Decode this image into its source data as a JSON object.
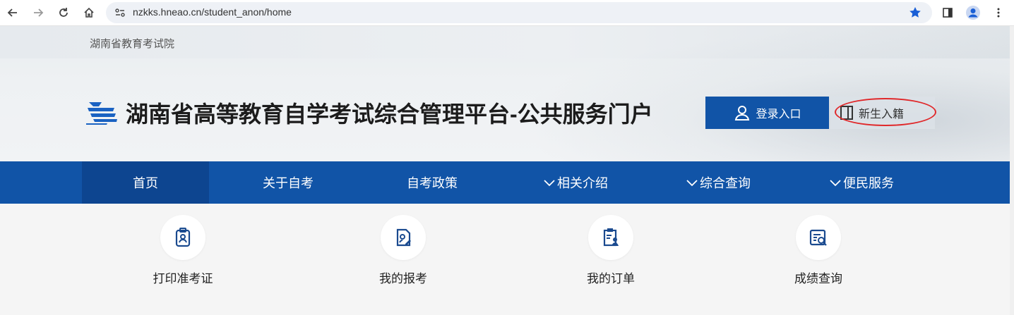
{
  "browser": {
    "url": "nzkks.hneao.cn/student_anon/home"
  },
  "header": {
    "org_name": "湖南省教育考试院",
    "title": "湖南省高等教育自学考试综合管理平台-公共服务门户",
    "login_label": "登录入口",
    "new_student_label": "新生入籍"
  },
  "nav": {
    "items": [
      {
        "label": "首页",
        "has_dropdown": false
      },
      {
        "label": "关于自考",
        "has_dropdown": false
      },
      {
        "label": "自考政策",
        "has_dropdown": false
      },
      {
        "label": "相关介绍",
        "has_dropdown": true
      },
      {
        "label": "综合查询",
        "has_dropdown": true
      },
      {
        "label": "便民服务",
        "has_dropdown": true
      }
    ]
  },
  "quick_links": [
    {
      "label": "打印准考证",
      "icon": "id-badge-icon"
    },
    {
      "label": "我的报考",
      "icon": "edit-document-icon"
    },
    {
      "label": "我的订单",
      "icon": "clipboard-user-icon"
    },
    {
      "label": "成绩查询",
      "icon": "search-document-icon"
    }
  ],
  "colors": {
    "brand_blue": "#1154a7",
    "nav_active": "#0d4590",
    "annotation_red": "#e0282a"
  }
}
